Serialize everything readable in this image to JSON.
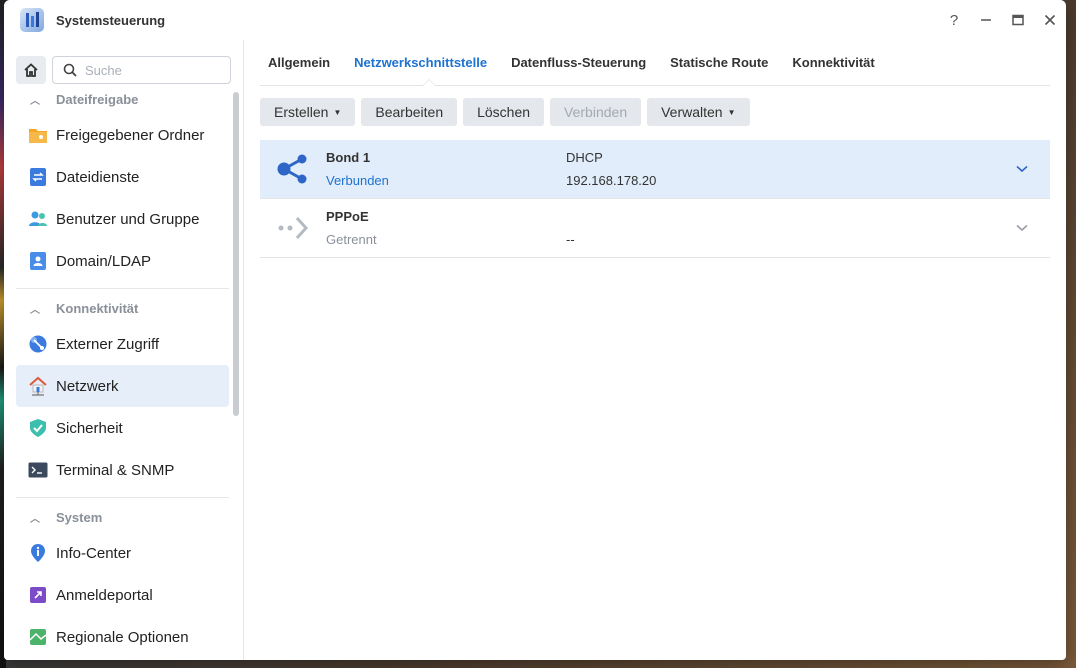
{
  "window": {
    "title": "Systemsteuerung",
    "controls": {
      "help": "?",
      "minimize": "—",
      "maximize": "▭",
      "close": "✕"
    }
  },
  "sidebar": {
    "search_placeholder": "Suche",
    "sections": [
      {
        "title": "Dateifreigabe",
        "items": [
          {
            "label": "Freigegebener Ordner",
            "icon": "folder-icon"
          },
          {
            "label": "Dateidienste",
            "icon": "file-services-icon"
          },
          {
            "label": "Benutzer und Gruppe",
            "icon": "users-icon"
          },
          {
            "label": "Domain/LDAP",
            "icon": "domain-icon"
          }
        ]
      },
      {
        "title": "Konnektivität",
        "items": [
          {
            "label": "Externer Zugriff",
            "icon": "external-access-icon"
          },
          {
            "label": "Netzwerk",
            "icon": "network-house-icon",
            "active": true
          },
          {
            "label": "Sicherheit",
            "icon": "shield-icon"
          },
          {
            "label": "Terminal & SNMP",
            "icon": "terminal-icon"
          }
        ]
      },
      {
        "title": "System",
        "items": [
          {
            "label": "Info-Center",
            "icon": "info-icon"
          },
          {
            "label": "Anmeldeportal",
            "icon": "login-portal-icon"
          },
          {
            "label": "Regionale Optionen",
            "icon": "region-icon"
          }
        ]
      }
    ]
  },
  "tabs": [
    "Allgemein",
    "Netzwerkschnittstelle",
    "Datenfluss-Steuerung",
    "Statische Route",
    "Konnektivität"
  ],
  "active_tab": "Netzwerkschnittstelle",
  "toolbar": {
    "create": "Erstellen",
    "edit": "Bearbeiten",
    "delete": "Löschen",
    "connect": "Verbinden",
    "manage": "Verwalten"
  },
  "interfaces": [
    {
      "name": "Bond 1",
      "status": "Verbunden",
      "mode": "DHCP",
      "ip": "192.168.178.20",
      "connected": true
    },
    {
      "name": "PPPoE",
      "status": "Getrennt",
      "mode": "",
      "ip": "--",
      "connected": false
    }
  ],
  "colors": {
    "accent": "#1e72d0",
    "selected_row": "#e2edfb",
    "active_nav": "#e6eef9"
  }
}
